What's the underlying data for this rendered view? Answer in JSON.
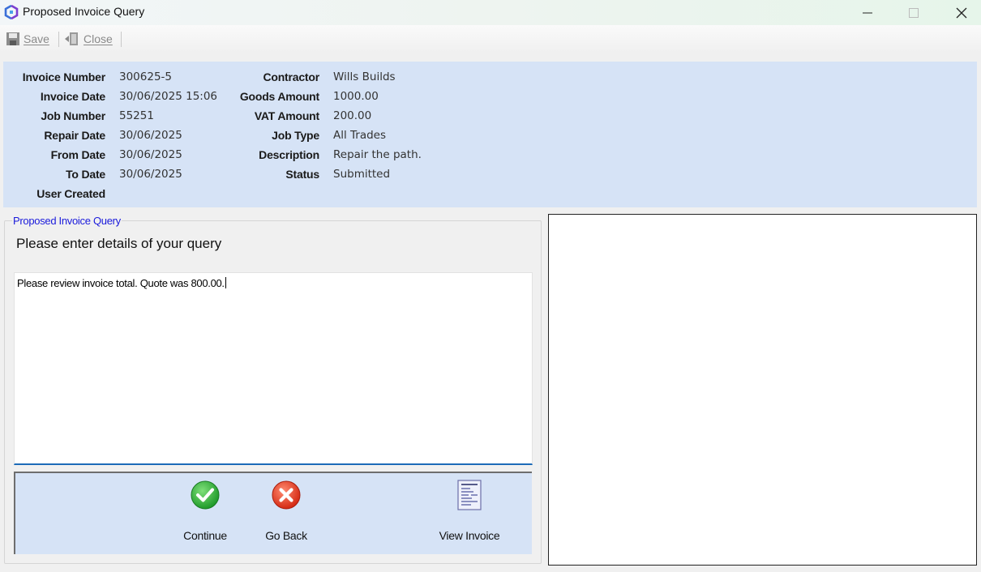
{
  "window": {
    "title": "Proposed Invoice Query",
    "icon": "app-logo-icon",
    "controls": [
      "minimize-icon",
      "maximize-icon",
      "close-icon"
    ]
  },
  "toolbar": {
    "save_label": "Save",
    "close_label": "Close"
  },
  "invoice": {
    "left": [
      {
        "label": "Invoice Number",
        "value": "300625-5"
      },
      {
        "label": "Invoice Date",
        "value": "30/06/2025 15:06"
      },
      {
        "label": "Job Number",
        "value": "55251"
      },
      {
        "label": "Repair Date",
        "value": "30/06/2025"
      },
      {
        "label": "From Date",
        "value": "30/06/2025"
      },
      {
        "label": "To Date",
        "value": "30/06/2025"
      },
      {
        "label": "User Created",
        "value": ""
      }
    ],
    "right": [
      {
        "label": "Contractor",
        "value": "Wills Builds"
      },
      {
        "label": "Goods Amount",
        "value": "1000.00"
      },
      {
        "label": "VAT Amount",
        "value": "200.00"
      },
      {
        "label": "Job Type",
        "value": "All Trades"
      },
      {
        "label": "Description",
        "value": "Repair the path."
      },
      {
        "label": "Status",
        "value": "Submitted"
      }
    ]
  },
  "query": {
    "group_title": "Proposed Invoice Query",
    "prompt": "Please enter details of your query",
    "text": "Please review invoice total. Quote was 800.00."
  },
  "actions": {
    "continue_label": "Continue",
    "goback_label": "Go Back",
    "view_label": "View Invoice"
  },
  "colors": {
    "info_panel": "#d6e3f6",
    "legend": "#1a1adb",
    "focus_underline": "#1d6bb8"
  }
}
